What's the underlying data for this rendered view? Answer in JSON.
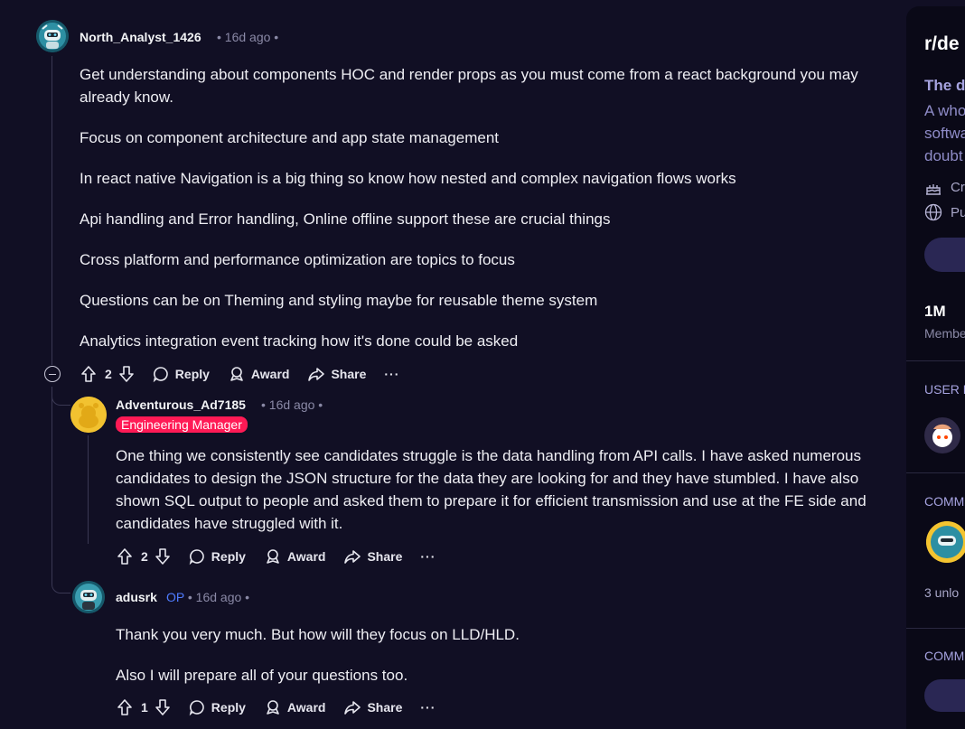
{
  "comments": [
    {
      "username": "North_Analyst_1426",
      "age": "16d ago",
      "paragraphs": [
        "Get understanding about components HOC and render props as you must come from a react background you may already know.",
        "Focus on component architecture and app state management",
        "In react native Navigation is a big thing so know how nested and complex navigation flows works",
        "Api handling and Error handling, Online offline support these are crucial things",
        "Cross platform and performance optimization are topics to focus",
        "Questions can be on Theming and styling maybe for reusable theme system",
        "Analytics integration event tracking how it's done could be asked"
      ],
      "votes": "2"
    },
    {
      "username": "Adventurous_Ad7185",
      "age": "16d ago",
      "flair": "Engineering Manager",
      "paragraphs": [
        "One thing we consistently see candidates struggle is the data handling from API calls. I have asked numerous candidates to design the JSON structure for the data they are looking for and they have stumbled. I have also shown SQL output to people and asked them to prepare it for efficient transmission and use at the FE side and candidates have struggled with it."
      ],
      "votes": "2"
    },
    {
      "username": "adusrk",
      "op_badge": "OP",
      "age": "16d ago",
      "paragraphs": [
        "Thank you very much. But how will they focus on LLD/HLD.",
        "Also I will prepare all of your questions too."
      ],
      "votes": "1"
    }
  ],
  "separator": "•",
  "actions": {
    "reply": "Reply",
    "award": "Award",
    "share": "Share",
    "more": "···"
  },
  "sidebar": {
    "title": "r/de",
    "tagline": "The d",
    "description": [
      "A who",
      "softwa",
      "doubt"
    ],
    "created": "Cr",
    "visibility": "Pu",
    "members_count": "1M",
    "members_label": "Membe",
    "section_user_flair": "USER F",
    "section_comm_1": "COMM",
    "unlock_text": "3 unlo",
    "section_comm_2": "COMM"
  },
  "colors": {
    "background": "#110f24",
    "sidebar": "#0a0917",
    "flair": "#ff1a55",
    "op": "#4f7bff",
    "muted": "#8a89a6",
    "sidebar_heading": "#a6a3e0"
  },
  "icons": [
    "upvote-icon",
    "downvote-icon",
    "reply-bubble-icon",
    "award-icon",
    "share-icon",
    "collapse-icon",
    "globe-icon",
    "cake-icon"
  ]
}
